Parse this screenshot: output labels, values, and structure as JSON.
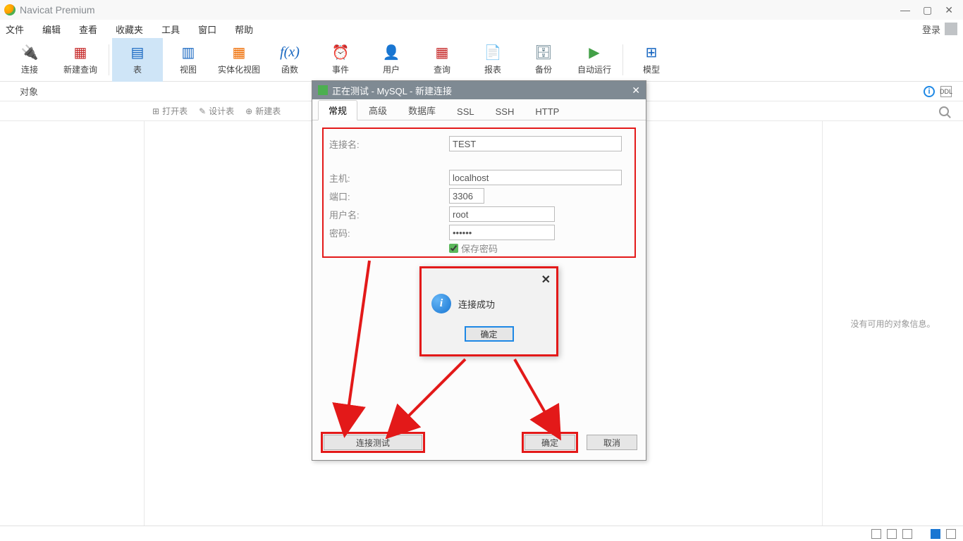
{
  "app": {
    "title": "Navicat Premium"
  },
  "window_controls": {
    "min": "—",
    "max": "▢",
    "close": "✕"
  },
  "menu": {
    "file": "文件",
    "edit": "编辑",
    "view": "查看",
    "favorites": "收藏夹",
    "tools": "工具",
    "window": "窗口",
    "help": "帮助",
    "login": "登录"
  },
  "toolbar": {
    "connect": "连接",
    "new_query": "新建查询",
    "table": "表",
    "view": "视图",
    "mview": "实体化视图",
    "function": "函数",
    "event": "事件",
    "user": "用户",
    "query": "查询",
    "report": "报表",
    "backup": "备份",
    "automation": "自动运行",
    "model": "模型"
  },
  "subtb": {
    "objects": "对象"
  },
  "actions": {
    "open_table": "打开表",
    "design_table": "设计表",
    "new_table": "新建表"
  },
  "right_panel": {
    "empty": "没有可用的对象信息。"
  },
  "dialog": {
    "title": "正在测试 - MySQL - 新建连接",
    "tabs": {
      "general": "常规",
      "advanced": "高级",
      "database": "数据库",
      "ssl": "SSL",
      "ssh": "SSH",
      "http": "HTTP"
    },
    "labels": {
      "conn_name": "连接名:",
      "host": "主机:",
      "port": "端口:",
      "username": "用户名:",
      "password": "密码:",
      "save_password": "保存密码"
    },
    "values": {
      "conn_name": "TEST",
      "host": "localhost",
      "port": "3306",
      "username": "root",
      "password": "••••••"
    },
    "buttons": {
      "test": "连接测试",
      "ok": "确定",
      "cancel": "取消"
    }
  },
  "msgbox": {
    "text": "连接成功",
    "ok": "确定"
  }
}
